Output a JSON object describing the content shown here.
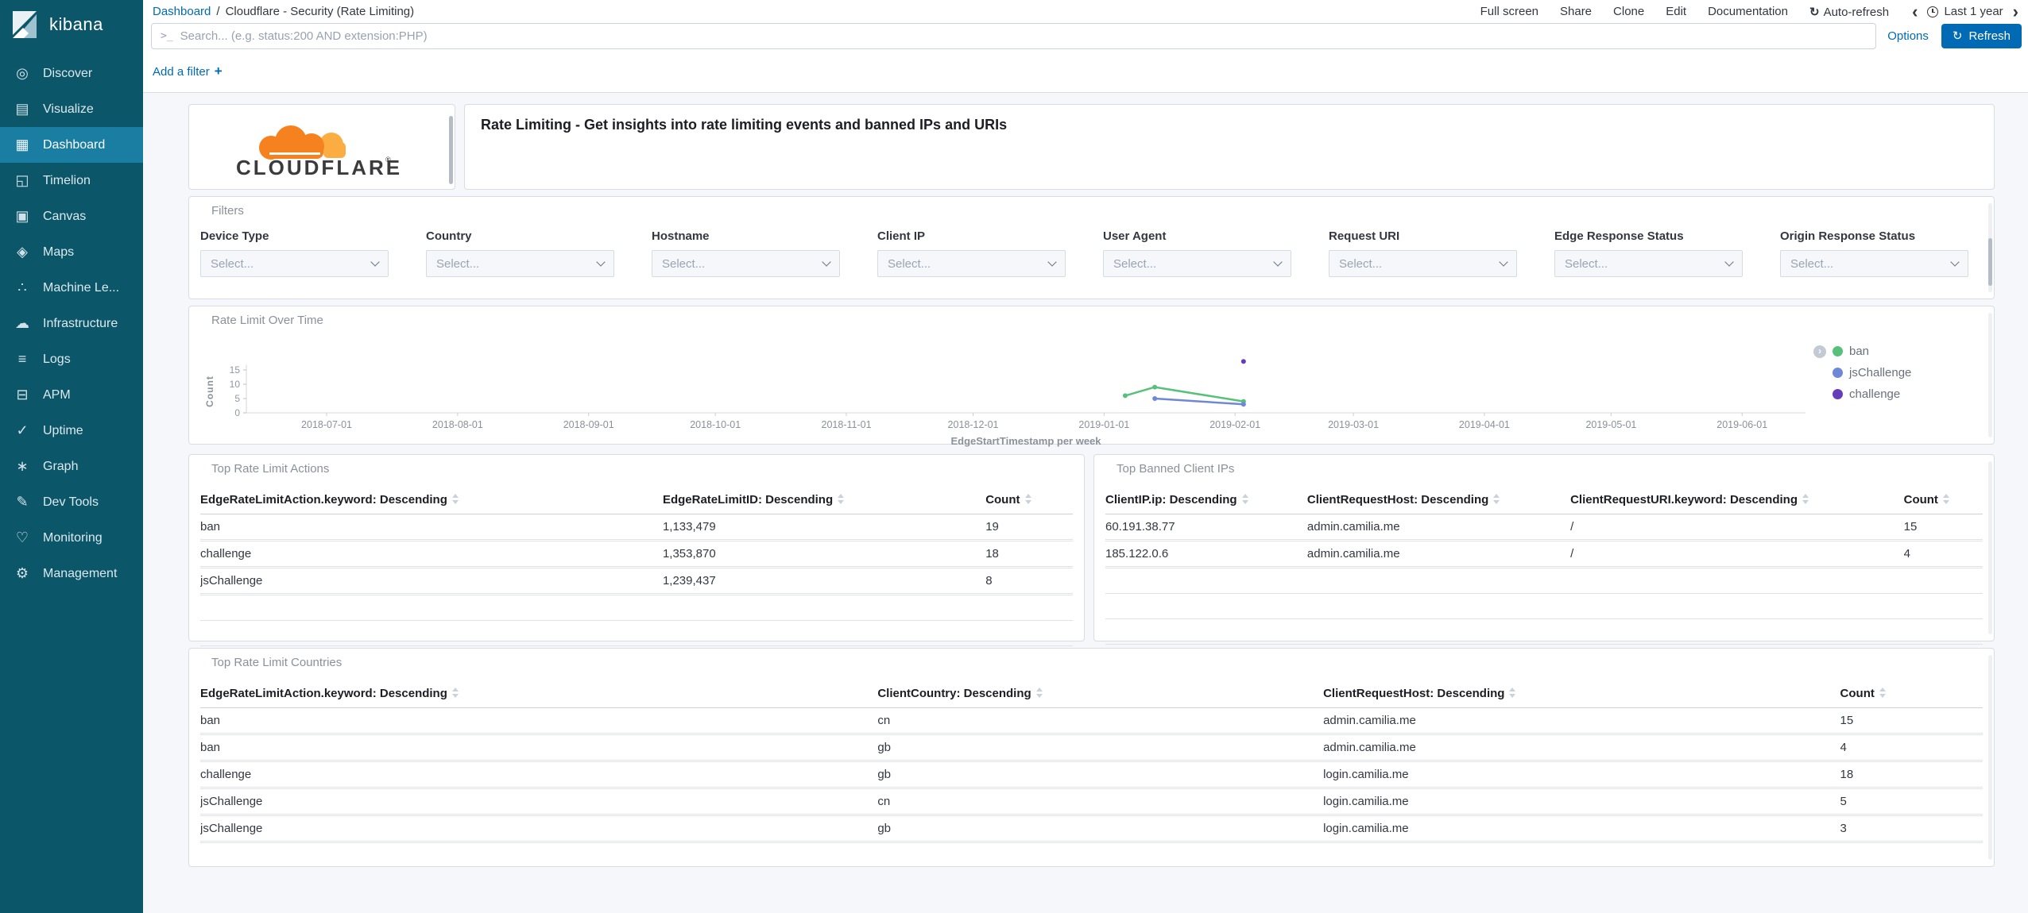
{
  "sidebar": {
    "logo_text": "kibana",
    "items": [
      {
        "id": "discover",
        "label": "Discover",
        "icon": "◎",
        "active": false
      },
      {
        "id": "visualize",
        "label": "Visualize",
        "icon": "▤",
        "active": false
      },
      {
        "id": "dashboard",
        "label": "Dashboard",
        "icon": "▦",
        "active": true
      },
      {
        "id": "timelion",
        "label": "Timelion",
        "icon": "◱",
        "active": false
      },
      {
        "id": "canvas",
        "label": "Canvas",
        "icon": "▣",
        "active": false
      },
      {
        "id": "maps",
        "label": "Maps",
        "icon": "◈",
        "active": false
      },
      {
        "id": "machine-learning",
        "label": "Machine Le...",
        "icon": "∴",
        "active": false
      },
      {
        "id": "infrastructure",
        "label": "Infrastructure",
        "icon": "☁",
        "active": false
      },
      {
        "id": "logs",
        "label": "Logs",
        "icon": "≡",
        "active": false
      },
      {
        "id": "apm",
        "label": "APM",
        "icon": "⊟",
        "active": false
      },
      {
        "id": "uptime",
        "label": "Uptime",
        "icon": "✓",
        "active": false
      },
      {
        "id": "graph",
        "label": "Graph",
        "icon": "∗",
        "active": false
      },
      {
        "id": "dev-tools",
        "label": "Dev Tools",
        "icon": "✎",
        "active": false
      },
      {
        "id": "monitoring",
        "label": "Monitoring",
        "icon": "♡",
        "active": false
      },
      {
        "id": "management",
        "label": "Management",
        "icon": "⚙",
        "active": false
      }
    ]
  },
  "topbar": {
    "breadcrumb": {
      "link": "Dashboard",
      "separator": "/",
      "current": "Cloudflare - Security (Rate Limiting)"
    },
    "menu": [
      "Full screen",
      "Share",
      "Clone",
      "Edit",
      "Documentation"
    ],
    "auto_refresh_label": "Auto-refresh",
    "time_range": "Last 1 year"
  },
  "searchbar": {
    "placeholder": "Search... (e.g. status:200 AND extension:PHP)",
    "options_label": "Options",
    "refresh_label": "Refresh"
  },
  "filter_bar": {
    "add_filter_label": "Add a filter"
  },
  "icons": {
    "console_prompt": ">_",
    "plus": "+",
    "auto_refresh": "↻",
    "refresh": "↻",
    "chevron_left": "‹",
    "chevron_right": "›",
    "legend_toggle": "›"
  },
  "header_panels": {
    "brand": "CLOUDFLARE",
    "registered_mark": "®",
    "description": "Rate Limiting - Get insights into rate limiting events and banned IPs and URIs"
  },
  "filters_panel": {
    "title": "Filters",
    "select_placeholder": "Select...",
    "fields": [
      "Device Type",
      "Country",
      "Hostname",
      "Client IP",
      "User Agent",
      "Request URI",
      "Edge Response Status",
      "Origin Response Status"
    ]
  },
  "chart_panel": {
    "title": "Rate Limit Over Time"
  },
  "chart_data": {
    "type": "line",
    "title": "Rate Limit Over Time",
    "xlabel": "EdgeStartTimestamp per week",
    "ylabel": "Count",
    "yticks": [
      0,
      5,
      10,
      15
    ],
    "ylim": [
      0,
      19
    ],
    "x_domain": [
      "2018-06-12",
      "2019-06-16"
    ],
    "x_tick_labels": [
      "2018-07-01",
      "2018-08-01",
      "2018-09-01",
      "2018-10-01",
      "2018-11-01",
      "2018-12-01",
      "2019-01-01",
      "2019-02-01",
      "2019-03-01",
      "2019-04-01",
      "2019-05-01",
      "2019-06-01"
    ],
    "legend_position": "right",
    "grid": false,
    "series": [
      {
        "name": "ban",
        "color": "#57c17b",
        "points": [
          [
            "2019-01-06",
            6
          ],
          [
            "2019-01-13",
            9
          ],
          [
            "2019-02-03",
            4
          ]
        ]
      },
      {
        "name": "jsChallenge",
        "color": "#6f87d8",
        "points": [
          [
            "2019-01-13",
            5
          ],
          [
            "2019-02-03",
            3
          ]
        ]
      },
      {
        "name": "challenge",
        "color": "#663db8",
        "points": [
          [
            "2019-02-03",
            18
          ]
        ]
      }
    ]
  },
  "tables": {
    "actions": {
      "title": "Top Rate Limit Actions",
      "columns": [
        "EdgeRateLimitAction.keyword: Descending",
        "EdgeRateLimitID: Descending",
        "Count"
      ],
      "rows": [
        [
          "ban",
          "1,133,479",
          "19"
        ],
        [
          "challenge",
          "1,353,870",
          "18"
        ],
        [
          "jsChallenge",
          "1,239,437",
          "8"
        ]
      ],
      "empty_rows": 2
    },
    "banned_ips": {
      "title": "Top Banned Client IPs",
      "columns": [
        "ClientIP.ip: Descending",
        "ClientRequestHost: Descending",
        "ClientRequestURI.keyword: Descending",
        "Count"
      ],
      "rows": [
        [
          "60.191.38.77",
          "admin.camilia.me",
          "/",
          "15"
        ],
        [
          "185.122.0.6",
          "admin.camilia.me",
          "/",
          "4"
        ]
      ],
      "empty_rows": 3
    },
    "countries": {
      "title": "Top Rate Limit Countries",
      "columns": [
        "EdgeRateLimitAction.keyword: Descending",
        "ClientCountry: Descending",
        "ClientRequestHost: Descending",
        "Count"
      ],
      "rows": [
        [
          "ban",
          "cn",
          "admin.camilia.me",
          "15"
        ],
        [
          "ban",
          "gb",
          "admin.camilia.me",
          "4"
        ],
        [
          "challenge",
          "gb",
          "login.camilia.me",
          "18"
        ],
        [
          "jsChallenge",
          "cn",
          "login.camilia.me",
          "5"
        ],
        [
          "jsChallenge",
          "gb",
          "login.camilia.me",
          "3"
        ]
      ],
      "empty_rows": 0
    }
  },
  "colors": {
    "sidebar_bg": "#0c5669",
    "sidebar_active": "#1a7da2",
    "link_blue": "#006BB4",
    "refresh_btn": "#006BB4",
    "content_bg": "#f5f7fa",
    "panel_border": "#d8dce4",
    "cloudflare_orange": "#f6821f",
    "cloudflare_light_orange": "#fbad41",
    "series_ban": "#57c17b",
    "series_jschallenge": "#6f87d8",
    "series_challenge": "#663db8"
  }
}
